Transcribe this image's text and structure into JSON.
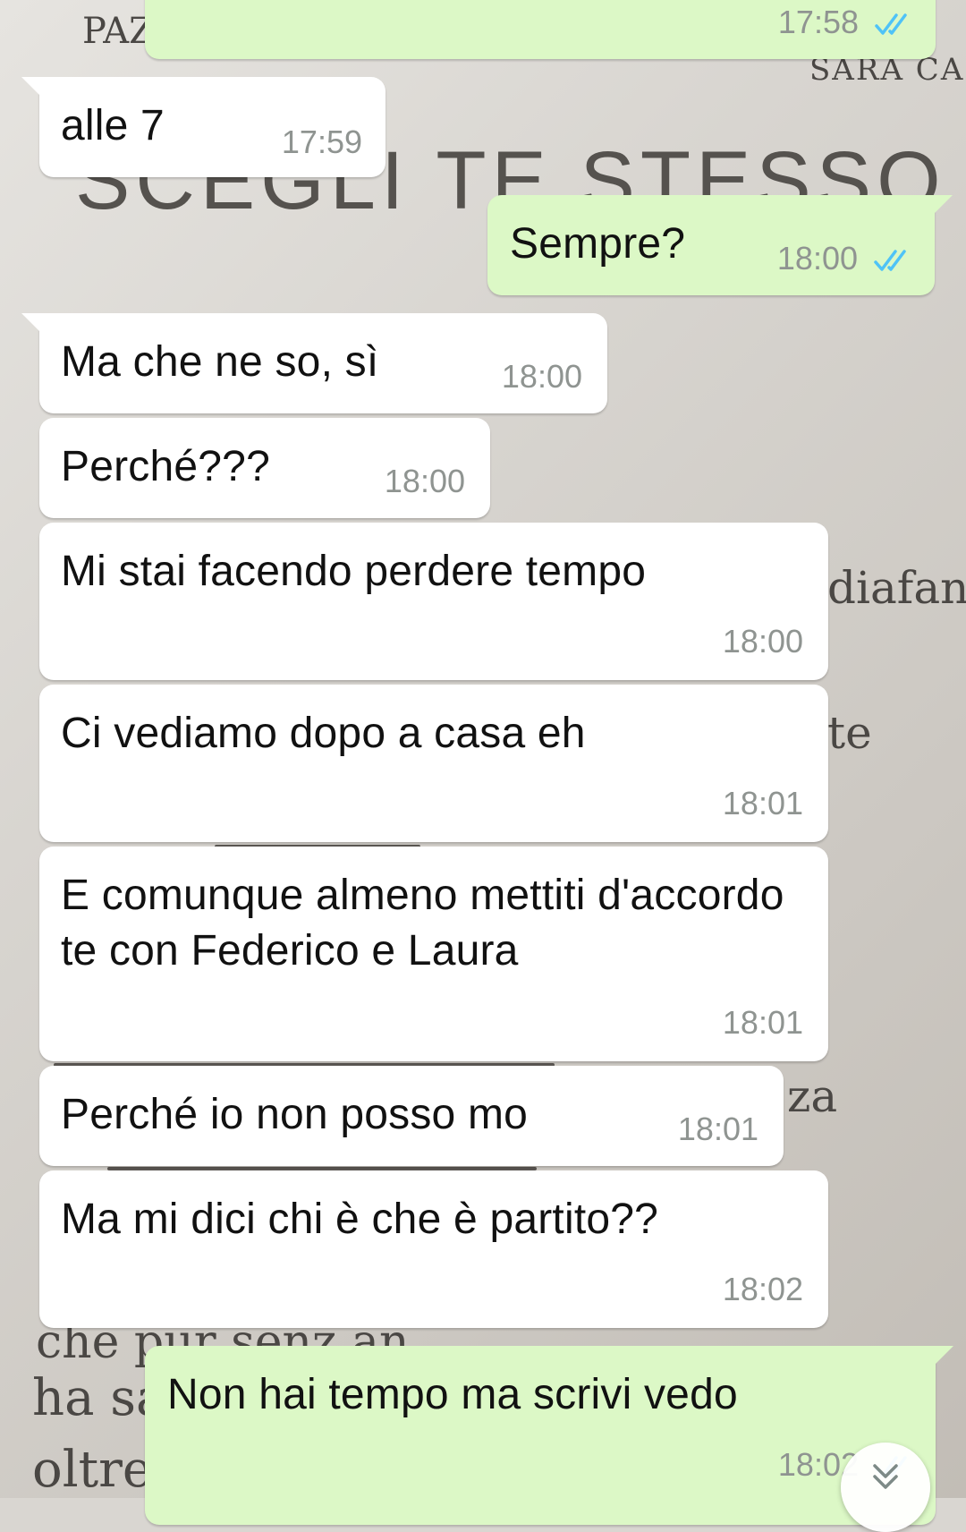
{
  "wallpaper": {
    "book_header_left": "PAZ",
    "book_header_right": "SARA CASS",
    "book_title": "SCEGLI TE STESSO",
    "fragment_1": "diafani",
    "fragment_2": "te",
    "fragment_3": "za",
    "fragment_4": "che pur senz an",
    "fragment_5": "ha sa",
    "fragment_6": "oltre"
  },
  "messages": [
    {
      "dir": "out",
      "text": "",
      "time": "17:58",
      "status": "read"
    },
    {
      "dir": "in",
      "text": "alle 7",
      "time": "17:59"
    },
    {
      "dir": "out",
      "text": "Sempre?",
      "time": "18:00",
      "status": "read"
    },
    {
      "dir": "in",
      "text": "Ma che ne so, sì",
      "time": "18:00"
    },
    {
      "dir": "in",
      "text": "Perché???",
      "time": "18:00"
    },
    {
      "dir": "in",
      "text": "Mi stai facendo perdere tempo",
      "time": "18:00"
    },
    {
      "dir": "in",
      "text": "Ci vediamo dopo a casa eh",
      "time": "18:01"
    },
    {
      "dir": "in",
      "text": "E comunque almeno mettiti d'accordo te con Federico e Laura",
      "time": "18:01"
    },
    {
      "dir": "in",
      "text": "Perché io non posso mo",
      "time": "18:01"
    },
    {
      "dir": "in",
      "text": "Ma mi dici chi è che è partito??",
      "time": "18:02"
    },
    {
      "dir": "out",
      "text": "Non hai tempo ma scrivi vedo",
      "time": "18:02",
      "status": "read"
    }
  ],
  "colors": {
    "incoming_bubble": "#ffffff",
    "outgoing_bubble": "#dcf8c6",
    "read_ticks": "#4fc3f7",
    "timestamp": "#8f9491"
  },
  "icons": {
    "read_receipt": "double-check-icon",
    "scroll_down": "chevron-double-down-icon"
  }
}
